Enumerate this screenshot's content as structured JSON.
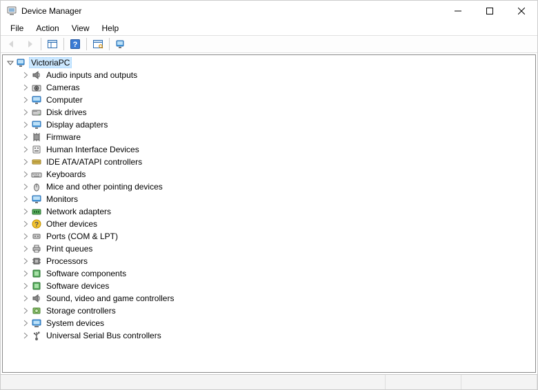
{
  "window": {
    "title": "Device Manager"
  },
  "menu": {
    "file": "File",
    "action": "Action",
    "view": "View",
    "help": "Help"
  },
  "tree": {
    "root": {
      "label": "VictoriaPC",
      "icon": "computer-icon",
      "expanded": true,
      "selected": true
    },
    "categories": [
      {
        "label": "Audio inputs and outputs",
        "icon": "speaker-icon"
      },
      {
        "label": "Cameras",
        "icon": "camera-icon"
      },
      {
        "label": "Computer",
        "icon": "monitor-icon"
      },
      {
        "label": "Disk drives",
        "icon": "disk-icon"
      },
      {
        "label": "Display adapters",
        "icon": "monitor-icon"
      },
      {
        "label": "Firmware",
        "icon": "chip-icon"
      },
      {
        "label": "Human Interface Devices",
        "icon": "hid-icon"
      },
      {
        "label": "IDE ATA/ATAPI controllers",
        "icon": "ide-icon"
      },
      {
        "label": "Keyboards",
        "icon": "keyboard-icon"
      },
      {
        "label": "Mice and other pointing devices",
        "icon": "mouse-icon"
      },
      {
        "label": "Monitors",
        "icon": "monitor-icon"
      },
      {
        "label": "Network adapters",
        "icon": "network-icon"
      },
      {
        "label": "Other devices",
        "icon": "unknown-icon"
      },
      {
        "label": "Ports (COM & LPT)",
        "icon": "port-icon"
      },
      {
        "label": "Print queues",
        "icon": "printer-icon"
      },
      {
        "label": "Processors",
        "icon": "cpu-icon"
      },
      {
        "label": "Software components",
        "icon": "software-icon"
      },
      {
        "label": "Software devices",
        "icon": "software-icon"
      },
      {
        "label": "Sound, video and game controllers",
        "icon": "speaker-icon"
      },
      {
        "label": "Storage controllers",
        "icon": "storage-icon"
      },
      {
        "label": "System devices",
        "icon": "system-icon"
      },
      {
        "label": "Universal Serial Bus controllers",
        "icon": "usb-icon"
      }
    ]
  }
}
